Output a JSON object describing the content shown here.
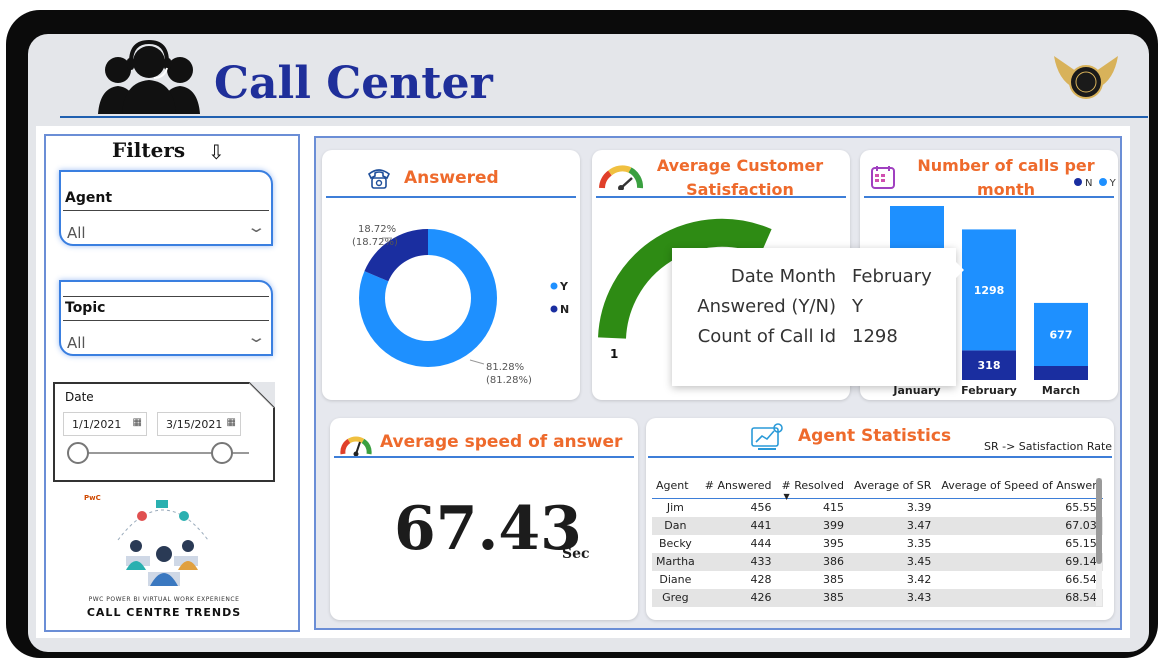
{
  "header": {
    "title": "Call Center",
    "agents_icon": "headset-agents-icon",
    "logo": "winged-emblem-logo"
  },
  "filters": {
    "title": "Filters",
    "arrow_icon": "down-arrow-icon",
    "agent": {
      "label": "Agent",
      "value": "All"
    },
    "topic": {
      "label": "Topic",
      "value": "All"
    },
    "date": {
      "label": "Date",
      "start": "1/1/2021",
      "end": "3/15/2021"
    },
    "promo": {
      "brand": "PwC",
      "subtitle": "PWC POWER BI VIRTUAL WORK EXPERIENCE",
      "title": "CALL CENTRE TRENDS"
    }
  },
  "answered": {
    "title": "Answered",
    "icon": "telephone-icon",
    "y_label_1": "81.28%",
    "y_label_2": "(81.28%)",
    "n_label_1": "18.72%",
    "n_label_2": "(18.72%)",
    "legend": [
      {
        "label": "Y",
        "color": "#1e90ff"
      },
      {
        "label": "N",
        "color": "#1a2ea0"
      }
    ]
  },
  "satisfaction": {
    "title_line1": "Average Customer",
    "title_line2": "Satisfaction",
    "icon": "gauge-icon",
    "min_label": "1",
    "gauge_color": "#2e8b14"
  },
  "calls_per_month": {
    "title_line1": "Number of calls per",
    "title_line2": "month",
    "icon": "calendar-icon",
    "legend": [
      {
        "label": "N",
        "color": "#1a2ea0"
      },
      {
        "label": "Y",
        "color": "#1e90ff"
      }
    ]
  },
  "tooltip": {
    "rows": [
      {
        "key": "Date Month",
        "value": "February"
      },
      {
        "key": "Answered (Y/N)",
        "value": "Y"
      },
      {
        "key": "Count of Call Id",
        "value": "1298"
      }
    ]
  },
  "speed": {
    "title": "Average speed of answer",
    "icon": "speedometer-icon",
    "value": "67.43",
    "unit": "Sec"
  },
  "agent_stats": {
    "title": "Agent Statistics",
    "icon": "analytics-icon",
    "note": "SR -> Satisfaction Rate",
    "columns": [
      "Agent",
      "# Answered",
      "# Resolved",
      "Average of SR",
      "Average of Speed of Answer"
    ],
    "rows": [
      [
        "Jim",
        "456",
        "415",
        "3.39",
        "65.55"
      ],
      [
        "Dan",
        "441",
        "399",
        "3.47",
        "67.03"
      ],
      [
        "Becky",
        "444",
        "395",
        "3.35",
        "65.15"
      ],
      [
        "Martha",
        "433",
        "386",
        "3.45",
        "69.14"
      ],
      [
        "Diane",
        "428",
        "385",
        "3.42",
        "66.54"
      ],
      [
        "Greg",
        "426",
        "385",
        "3.43",
        "68.54"
      ]
    ]
  },
  "chart_data": [
    {
      "type": "pie",
      "title": "Answered",
      "categories": [
        "Y",
        "N"
      ],
      "values": [
        81.28,
        18.72
      ]
    },
    {
      "type": "bar",
      "title": "Number of calls per month",
      "categories": [
        "January",
        "February",
        "March"
      ],
      "series": [
        {
          "name": "N",
          "values": [
            null,
            318,
            null
          ]
        },
        {
          "name": "Y",
          "values": [
            null,
            1298,
            677
          ]
        }
      ]
    }
  ]
}
